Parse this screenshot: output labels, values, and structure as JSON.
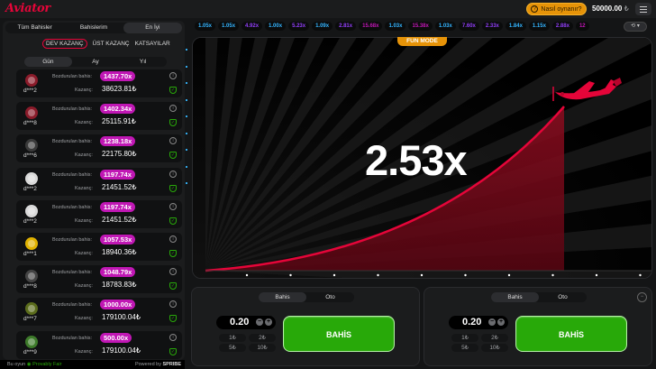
{
  "header": {
    "logo": "Aviator",
    "how_to_play": "Nasıl oynanır?",
    "balance": "50000.00",
    "currency": "₺"
  },
  "leftpanel": {
    "tabs": [
      "Tüm Bahisler",
      "Bahislerim",
      "En İyi"
    ],
    "subtabs": [
      "DEV KAZANÇ",
      "ÜST KAZANÇ",
      "KATSAYILAR"
    ],
    "periods": [
      "Gün",
      "Ay",
      "Yıl"
    ],
    "bet_label": "Bozdurulan bahis",
    "win_label": "Kazanç",
    "rows": [
      {
        "user": "d***2",
        "mult": "1437.70x",
        "win": "38623.81₺",
        "avatar_color": "#8a1b2a"
      },
      {
        "user": "d***8",
        "mult": "1402.34x",
        "win": "25115.91₺",
        "avatar_color": "#8a1b2a"
      },
      {
        "user": "d***6",
        "mult": "1238.18x",
        "win": "22175.80₺",
        "avatar_color": "#3a3a3a"
      },
      {
        "user": "d***2",
        "mult": "1197.74x",
        "win": "21451.52₺",
        "avatar_color": "#d9d9d9"
      },
      {
        "user": "d***2",
        "mult": "1197.74x",
        "win": "21451.52₺",
        "avatar_color": "#d9d9d9"
      },
      {
        "user": "d***1",
        "mult": "1057.53x",
        "win": "18940.36₺",
        "avatar_color": "#e0b200"
      },
      {
        "user": "d***8",
        "mult": "1048.79x",
        "win": "18783.83₺",
        "avatar_color": "#444444"
      },
      {
        "user": "d***7",
        "mult": "1000.00x",
        "win": "179100.04₺",
        "avatar_color": "#5a6b1b"
      },
      {
        "user": "d***9",
        "mult": "500.00x",
        "win": "179100.04₺",
        "avatar_color": "#3d7a2a"
      }
    ]
  },
  "footer": {
    "provably_prefix": "Bu oyun",
    "provably": "Provably Fair",
    "powered_prefix": "Powered by",
    "powered": "SPRIBE"
  },
  "history": [
    {
      "v": "1.05x",
      "c": "#34b4ff"
    },
    {
      "v": "1.05x",
      "c": "#34b4ff"
    },
    {
      "v": "4.92x",
      "c": "#913ef8"
    },
    {
      "v": "1.00x",
      "c": "#34b4ff"
    },
    {
      "v": "5.23x",
      "c": "#913ef8"
    },
    {
      "v": "1.09x",
      "c": "#34b4ff"
    },
    {
      "v": "2.81x",
      "c": "#913ef8"
    },
    {
      "v": "15.68x",
      "c": "#c017b4"
    },
    {
      "v": "1.03x",
      "c": "#34b4ff"
    },
    {
      "v": "15.38x",
      "c": "#c017b4"
    },
    {
      "v": "1.03x",
      "c": "#34b4ff"
    },
    {
      "v": "7.60x",
      "c": "#913ef8"
    },
    {
      "v": "2.33x",
      "c": "#913ef8"
    },
    {
      "v": "1.84x",
      "c": "#34b4ff"
    },
    {
      "v": "1.15x",
      "c": "#34b4ff"
    },
    {
      "v": "2.88x",
      "c": "#913ef8"
    },
    {
      "v": "12",
      "c": "#c017b4"
    }
  ],
  "game": {
    "mode": "FUN MODE",
    "multiplier": "2.53x"
  },
  "betpanels": [
    {
      "tabs": [
        "Bahis",
        "Oto"
      ],
      "amount": "0.20",
      "chips": [
        "1₺",
        "2₺",
        "5₺",
        "10₺"
      ],
      "button": "BAHİS"
    },
    {
      "tabs": [
        "Bahis",
        "Oto"
      ],
      "amount": "0.20",
      "chips": [
        "1₺",
        "2₺",
        "5₺",
        "10₺"
      ],
      "button": "BAHİS"
    }
  ]
}
